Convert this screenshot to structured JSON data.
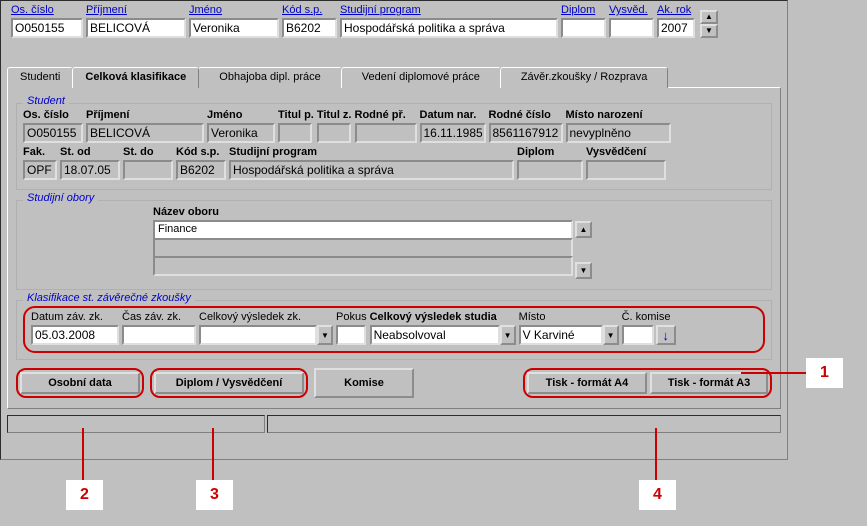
{
  "header": {
    "os_cislo_label": "Os. číslo",
    "os_cislo": "O050155",
    "prijmeni_label": "Příjmení",
    "prijmeni": "BELICOVÁ",
    "jmeno_label": "Jméno",
    "jmeno": "Veronika",
    "kod_sp_label": "Kód s.p.",
    "kod_sp": "B6202",
    "program_label": "Studijní program",
    "program": "Hospodářská politika a správa",
    "diplom_label": "Diplom",
    "diplom": "",
    "vysved_label": "Vysvěd.",
    "vysved": "",
    "ak_rok_label": "Ak. rok",
    "ak_rok": "2007"
  },
  "tabs": {
    "studenti": "Studenti",
    "celkova": "Celková klasifikace",
    "obhajoba": "Obhajoba dipl. práce",
    "vedeni": "Vedení diplomové práce",
    "zaver": "Závěr.zkoušky / Rozprava"
  },
  "student_group": {
    "title": "Student",
    "os_cislo_label": "Os. číslo",
    "os_cislo": "O050155",
    "prijmeni_label": "Příjmení",
    "prijmeni": "BELICOVÁ",
    "jmeno_label": "Jméno",
    "jmeno": "Veronika",
    "titul_p_label": "Titul p.",
    "titul_p": "",
    "titul_z_label": "Titul z.",
    "titul_z": "",
    "rodne_pr_label": "Rodné př.",
    "rodne_pr": "",
    "datum_nar_label": "Datum nar.",
    "datum_nar": "16.11.1985",
    "rodne_cislo_label": "Rodné číslo",
    "rodne_cislo": "8561167912",
    "misto_nar_label": "Místo narození",
    "misto_nar": "nevyplněno",
    "fak_label": "Fak.",
    "fak": "OPF",
    "st_od_label": "St. od",
    "st_od": "18.07.05",
    "st_do_label": "St. do",
    "st_do": "",
    "kod_sp_label": "Kód s.p.",
    "kod_sp": "B6202",
    "program_label": "Studijní program",
    "program": "Hospodářská politika a správa",
    "diplom_label": "Diplom",
    "diplom": "",
    "vysved_label": "Vysvědčení",
    "vysved": ""
  },
  "obory_group": {
    "title": "Studijní obory",
    "nazev_label": "Název oboru",
    "rows": [
      "Finance",
      "",
      ""
    ]
  },
  "klasifikace_group": {
    "title": "Klasifikace st. závěrečné zkoušky",
    "datum_label": "Datum záv. zk.",
    "datum": "05.03.2008",
    "cas_label": "Čas záv. zk.",
    "cas": "",
    "celkovy_label": "Celkový výsledek zk.",
    "celkovy": "",
    "pokus_label": "Pokus",
    "pokus": "",
    "studia_label": "Celkový výsledek studia",
    "studia": "Neabsolvoval",
    "misto_label": "Místo",
    "misto": "V Karviné",
    "komise_label": "Č. komise",
    "komise": ""
  },
  "buttons": {
    "osobni": "Osobní data",
    "diplom": "Diplom / Vysvědčení",
    "komise": "Komise",
    "tisk_a4": "Tisk - formát A4",
    "tisk_a3": "Tisk - formát A3"
  },
  "callouts": {
    "n1": "1",
    "n2": "2",
    "n3": "3",
    "n4": "4"
  },
  "icons": {
    "down_arrow": "↓"
  }
}
